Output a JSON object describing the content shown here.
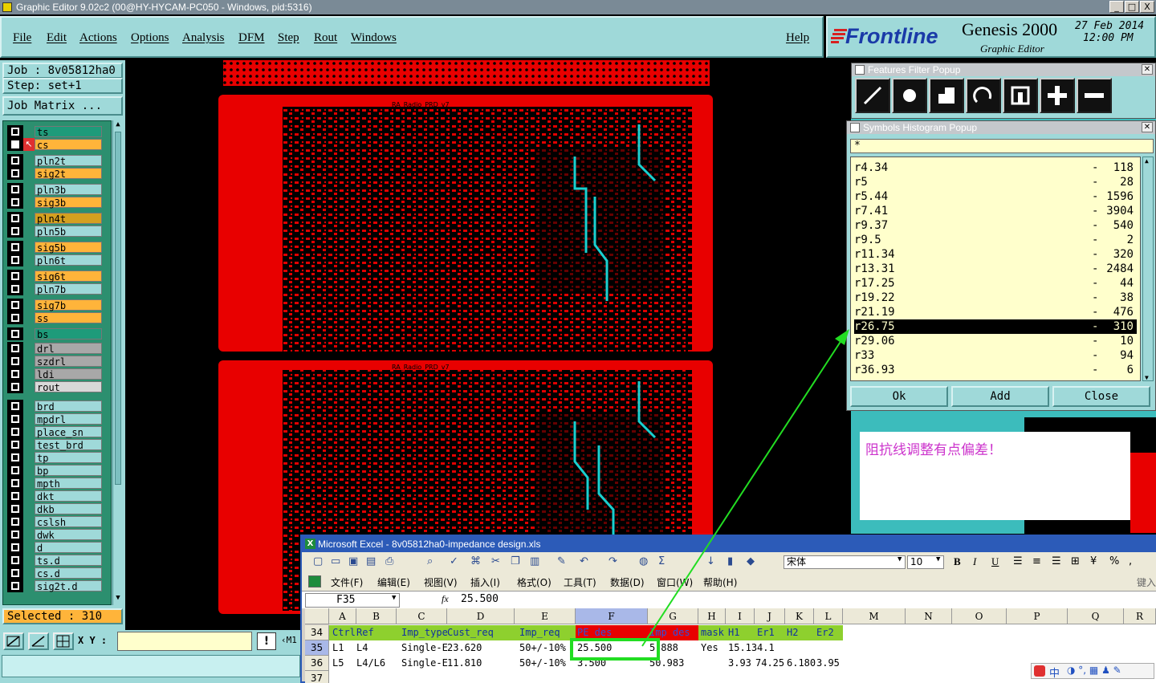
{
  "window": {
    "title": "Graphic Editor 9.02c2 (00@HY-HYCAM-PC050 - Windows, pid:5316)",
    "controls": [
      "_",
      "□",
      "X"
    ]
  },
  "menu": {
    "items": [
      "File",
      "Edit",
      "Actions",
      "Options",
      "Analysis",
      "DFM",
      "Step",
      "Rout",
      "Windows"
    ],
    "help": "Help"
  },
  "brand": {
    "logo": "Frontline",
    "product": "Genesis 2000",
    "subtitle": "Graphic Editor",
    "date": "27 Feb 2014",
    "time": "12:00 PM"
  },
  "job": {
    "job_label": "Job : 8v05812ha0",
    "step_label": "Step: set+1",
    "matrix_button": "Job Matrix ..."
  },
  "layers": [
    {
      "name": "ts",
      "color": "#1e9b7a",
      "group": 1
    },
    {
      "name": "cs",
      "color": "#ffb43a",
      "group": 1,
      "active": true
    },
    {
      "name": "pln2t",
      "color": "#9fd9d9",
      "group": 1
    },
    {
      "name": "sig2t",
      "color": "#ffb43a",
      "group": 1
    },
    {
      "name": "pln3b",
      "color": "#9fd9d9",
      "group": 1
    },
    {
      "name": "sig3b",
      "color": "#ffb43a",
      "group": 1
    },
    {
      "name": "pln4t",
      "color": "#d4a020",
      "group": 1
    },
    {
      "name": "pln5b",
      "color": "#9fd9d9",
      "group": 1
    },
    {
      "name": "sig5b",
      "color": "#ffb43a",
      "group": 1
    },
    {
      "name": "pln6t",
      "color": "#9fd9d9",
      "group": 1
    },
    {
      "name": "sig6t",
      "color": "#ffb43a",
      "group": 1
    },
    {
      "name": "pln7b",
      "color": "#9fd9d9",
      "group": 1
    },
    {
      "name": "sig7b",
      "color": "#ffb43a",
      "group": 1
    },
    {
      "name": "ss",
      "color": "#ffb43a",
      "group": 1
    },
    {
      "name": "bs",
      "color": "#1e9b7a",
      "group": 1
    },
    {
      "name": "drl",
      "color": "#a8a8a8",
      "group": 2
    },
    {
      "name": "szdrl",
      "color": "#a8a8a8",
      "group": 2
    },
    {
      "name": "ldi",
      "color": "#a8a8a8",
      "group": 2
    },
    {
      "name": "rout",
      "color": "#d8d8d8",
      "group": 2
    },
    {
      "name": "brd",
      "color": "#9fd9d9",
      "group": 3
    },
    {
      "name": "mpdrl",
      "color": "#9fd9d9",
      "group": 3
    },
    {
      "name": "place_sn",
      "color": "#9fd9d9",
      "group": 3
    },
    {
      "name": "test_brd",
      "color": "#9fd9d9",
      "group": 3
    },
    {
      "name": "tp",
      "color": "#9fd9d9",
      "group": 3
    },
    {
      "name": "bp",
      "color": "#9fd9d9",
      "group": 3
    },
    {
      "name": "mpth",
      "color": "#9fd9d9",
      "group": 3
    },
    {
      "name": "dkt",
      "color": "#9fd9d9",
      "group": 3
    },
    {
      "name": "dkb",
      "color": "#9fd9d9",
      "group": 3
    },
    {
      "name": "cslsh",
      "color": "#9fd9d9",
      "group": 3
    },
    {
      "name": "dwk",
      "color": "#9fd9d9",
      "group": 3
    },
    {
      "name": "d",
      "color": "#9fd9d9",
      "group": 3
    },
    {
      "name": "ts.d",
      "color": "#9fd9d9",
      "group": 3
    },
    {
      "name": "cs.d",
      "color": "#9fd9d9",
      "group": 3
    },
    {
      "name": "sig2t.d",
      "color": "#9fd9d9",
      "group": 3
    }
  ],
  "status": {
    "selected": "Selected : 310",
    "xy_label": "X Y :",
    "xy_value": "",
    "m1": "M1"
  },
  "board": {
    "text_top": "RA_Radio_PRD_v7",
    "text_bottom": "RA_Radio_PRD_v7"
  },
  "features_filter": {
    "title": "Features Filter Popup",
    "buttons": [
      "line-icon",
      "pad-icon",
      "surface-icon",
      "arc-icon",
      "text-icon",
      "plus-icon",
      "minus-icon"
    ]
  },
  "histogram": {
    "title": "Symbols Histogram Popup",
    "filter": "*",
    "rows": [
      {
        "symbol": "r4.34",
        "count": "118"
      },
      {
        "symbol": "r5",
        "count": "28"
      },
      {
        "symbol": "r5.44",
        "count": "1596"
      },
      {
        "symbol": "r7.41",
        "count": "3904"
      },
      {
        "symbol": "r9.37",
        "count": "540"
      },
      {
        "symbol": "r9.5",
        "count": "2"
      },
      {
        "symbol": "r11.34",
        "count": "320"
      },
      {
        "symbol": "r13.31",
        "count": "2484"
      },
      {
        "symbol": "r17.25",
        "count": "44"
      },
      {
        "symbol": "r19.22",
        "count": "38"
      },
      {
        "symbol": "r21.19",
        "count": "476"
      },
      {
        "symbol": "r26.75",
        "count": "310",
        "selected": true
      },
      {
        "symbol": "r29.06",
        "count": "10"
      },
      {
        "symbol": "r33",
        "count": "94"
      },
      {
        "symbol": "r36.93",
        "count": "6"
      }
    ],
    "buttons": {
      "ok": "Ok",
      "add": "Add",
      "close": "Close"
    }
  },
  "note": {
    "text": "阻抗线调整有点偏差！",
    "color": "#cc33cc"
  },
  "excel": {
    "title": "Microsoft Excel - 8v05812ha0-impedance design.xls",
    "font_name": "宋体",
    "font_size": "10",
    "menu": [
      "文件(F)",
      "编辑(E)",
      "视图(V)",
      "插入(I)",
      "格式(O)",
      "工具(T)",
      "数据(D)",
      "窗口(W)",
      "帮助(H)"
    ],
    "menu_hint": "键入",
    "name_box": "F35",
    "fx": "fx",
    "formula": "25.500",
    "columns": [
      "A",
      "B",
      "C",
      "D",
      "E",
      "F",
      "G",
      "H",
      "I",
      "J",
      "K",
      "L",
      "M",
      "N",
      "O",
      "P",
      "Q",
      "R"
    ],
    "row_numbers": [
      "34",
      "35",
      "36",
      "37"
    ],
    "header_row": [
      "Ctrl",
      "Ref",
      "Imp_type",
      "Cust_req",
      "Imp_req",
      "PE des",
      "Imp des",
      "mask",
      "H1",
      "Er1",
      "H2",
      "Er2"
    ],
    "rows": [
      [
        "L1",
        "L4",
        "Single-E",
        "23.620",
        "50+/-10%",
        "25.500",
        "5",
        ".888",
        "Yes",
        "15.13",
        "4.1",
        "",
        ""
      ],
      [
        "L5",
        "L4/L6",
        "Single-E",
        "11.810",
        "50+/-10%",
        "3.500",
        "",
        "50.983",
        "",
        "3.93",
        "74.25",
        "6.180",
        "3.95"
      ]
    ],
    "ime": "中"
  }
}
